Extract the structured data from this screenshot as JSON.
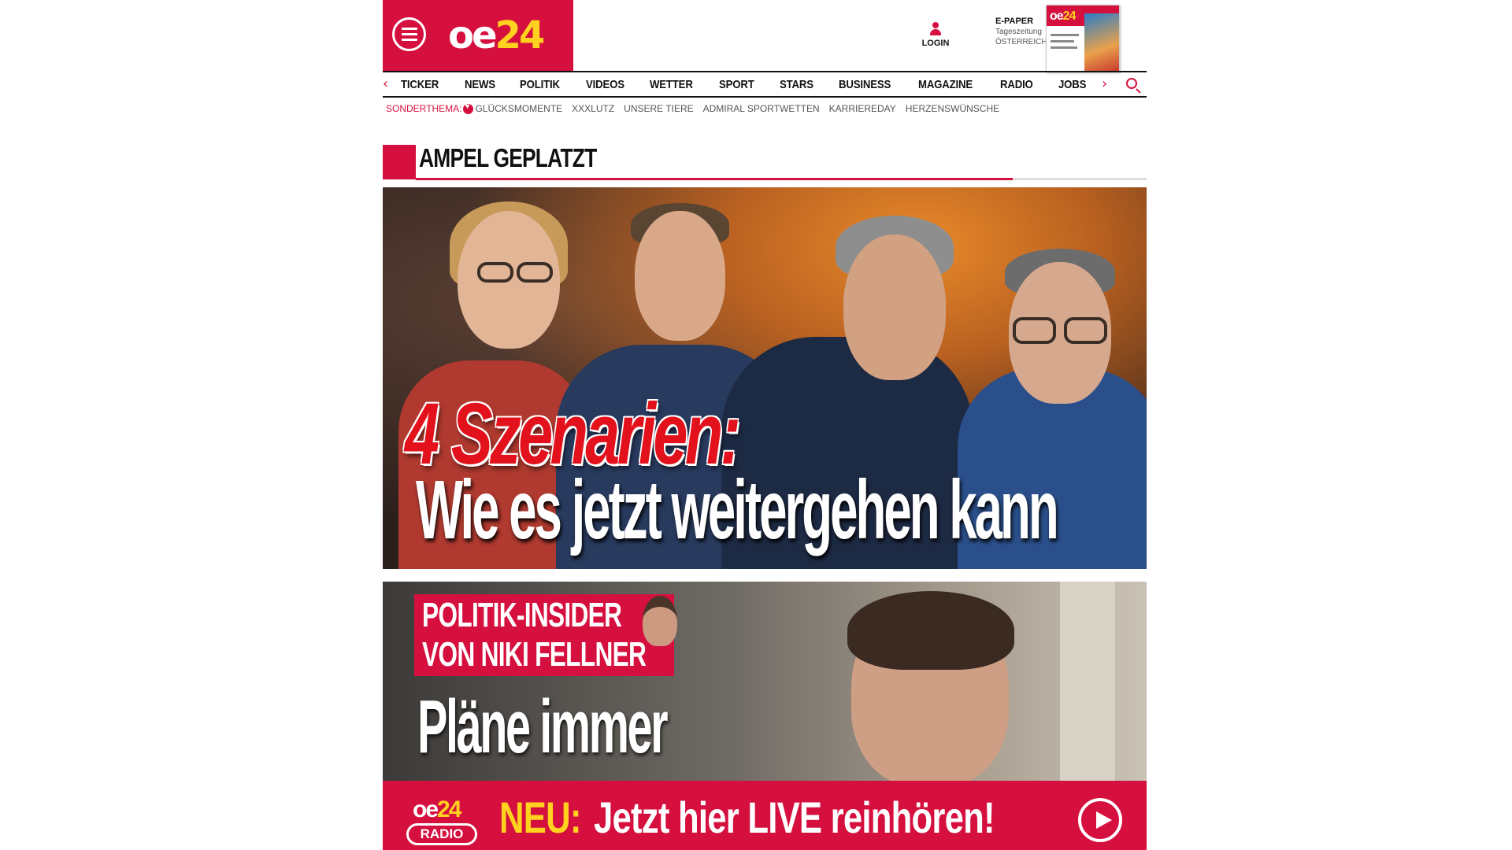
{
  "header": {
    "logo_oe": "oe",
    "logo_24": "24",
    "login_label": "LOGIN",
    "epaper_title": "E-PAPER",
    "epaper_line1": "Tageszeitung",
    "epaper_line2": "ÖSTERREICH",
    "brand_color": "#d5103e",
    "accent_color": "#ffd21f"
  },
  "nav": {
    "items": [
      "TICKER",
      "NEWS",
      "POLITIK",
      "VIDEOS",
      "WETTER",
      "SPORT",
      "STARS",
      "BUSINESS",
      "MAGAZINE",
      "RADIO",
      "JOBS"
    ],
    "prev_icon": "chevron-left-icon",
    "next_icon": "chevron-right-icon",
    "search_icon": "search-icon"
  },
  "subnav": {
    "label": "SONDERTHEMA:",
    "items": [
      "GLÜCKSMOMENTE",
      "XXXLUTZ",
      "UNSERE TIERE",
      "ADMIRAL SPORTWETTEN",
      "KARRIEREDAY",
      "HERZENSWÜNSCHE"
    ]
  },
  "section": {
    "title": "AMPEL GEPLATZT"
  },
  "hero": {
    "headline_red": "4 Szenarien:",
    "headline_white": "Wie es jetzt weitergehen kann"
  },
  "insider": {
    "badge_line1": "POLITIK-INSIDER",
    "badge_line2": "VON NIKI FELLNER",
    "headline": "Pläne immer"
  },
  "radio": {
    "logo_oe": "oe",
    "logo_24": "24",
    "logo_radio": "RADIO",
    "neu": "NEU:",
    "text": "Jetzt hier LIVE reinhören!"
  }
}
